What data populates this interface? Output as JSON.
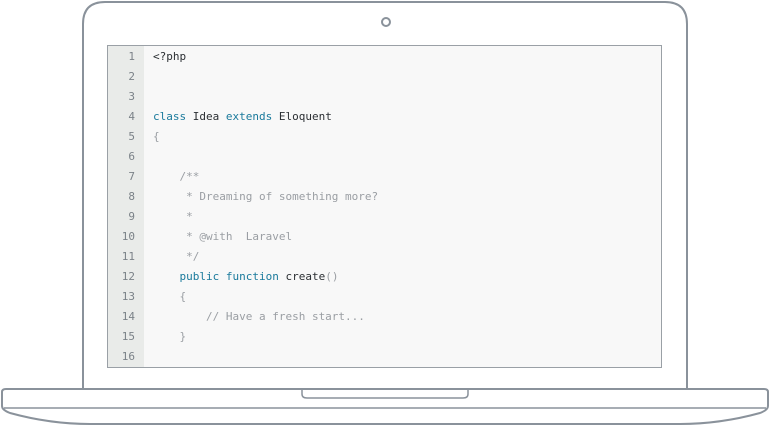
{
  "editor": {
    "lines": [
      {
        "number": "1",
        "tokens": [
          {
            "text": "<?php",
            "kind": "plain"
          }
        ]
      },
      {
        "number": "2",
        "tokens": []
      },
      {
        "number": "3",
        "tokens": []
      },
      {
        "number": "4",
        "tokens": [
          {
            "text": "class",
            "kind": "keyword"
          },
          {
            "text": " Idea ",
            "kind": "plain"
          },
          {
            "text": "extends",
            "kind": "keyword"
          },
          {
            "text": " Eloquent",
            "kind": "plain"
          }
        ]
      },
      {
        "number": "5",
        "tokens": [
          {
            "text": "{",
            "kind": "comment"
          }
        ]
      },
      {
        "number": "6",
        "tokens": []
      },
      {
        "number": "7",
        "tokens": [
          {
            "text": "    /**",
            "kind": "comment"
          }
        ]
      },
      {
        "number": "8",
        "tokens": [
          {
            "text": "     * Dreaming of something more?",
            "kind": "comment"
          }
        ]
      },
      {
        "number": "9",
        "tokens": [
          {
            "text": "     *",
            "kind": "comment"
          }
        ]
      },
      {
        "number": "10",
        "tokens": [
          {
            "text": "     * @with  Laravel",
            "kind": "comment"
          }
        ]
      },
      {
        "number": "11",
        "tokens": [
          {
            "text": "     */",
            "kind": "comment"
          }
        ]
      },
      {
        "number": "12",
        "tokens": [
          {
            "text": "    ",
            "kind": "plain"
          },
          {
            "text": "public",
            "kind": "keyword"
          },
          {
            "text": " ",
            "kind": "plain"
          },
          {
            "text": "function",
            "kind": "keyword"
          },
          {
            "text": " create",
            "kind": "plain"
          },
          {
            "text": "()",
            "kind": "comment"
          }
        ]
      },
      {
        "number": "13",
        "tokens": [
          {
            "text": "    {",
            "kind": "comment"
          }
        ]
      },
      {
        "number": "14",
        "tokens": [
          {
            "text": "        // Have a fresh start...",
            "kind": "comment"
          }
        ]
      },
      {
        "number": "15",
        "tokens": [
          {
            "text": "    }",
            "kind": "comment"
          }
        ]
      },
      {
        "number": "16",
        "tokens": []
      }
    ]
  },
  "colors": {
    "frame_stroke": "#8a929b",
    "editor_background": "#f8f8f8",
    "gutter_background": "#e9ebe9",
    "keyword": "#1a7a9c",
    "comment": "#9a9ea3",
    "plain": "#2b2f33"
  }
}
